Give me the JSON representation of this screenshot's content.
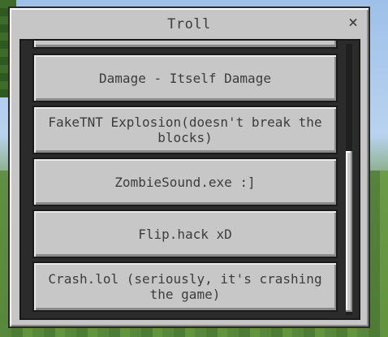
{
  "dialog": {
    "title": "Troll",
    "close_label": "×"
  },
  "items": [
    {
      "label": "Damage - Itself Damage"
    },
    {
      "label": "FakeTNT Explosion(doesn't break the blocks)"
    },
    {
      "label": "ZombieSound.exe :]"
    },
    {
      "label": "Flip.hack xD"
    },
    {
      "label": "Crash.lol (seriously, it's crashing the game)"
    }
  ],
  "scroll": {
    "position": 0.62
  },
  "colors": {
    "panel": "#c6c6c6",
    "list_background": "#2b2b2b",
    "button": "#c7c7c7",
    "text": "#3c3c3c"
  }
}
